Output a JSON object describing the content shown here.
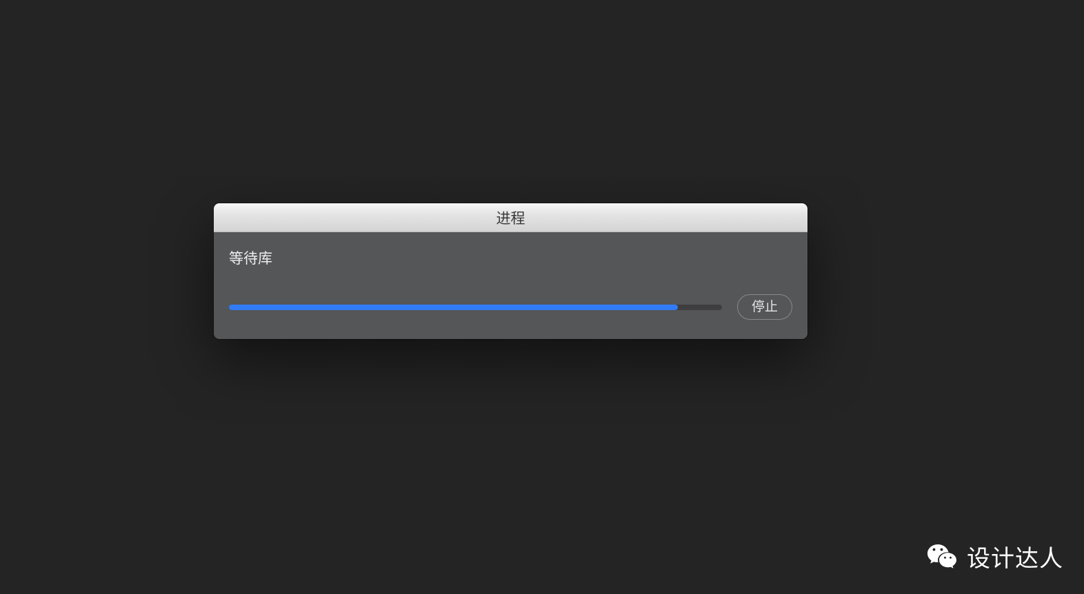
{
  "dialog": {
    "title": "进程",
    "status_label": "等待库",
    "progress_percent": 91,
    "stop_label": "停止"
  },
  "watermark": {
    "text": "设计达人"
  },
  "colors": {
    "accent": "#327bf6",
    "background": "#242424",
    "dialog_body": "#555658"
  }
}
